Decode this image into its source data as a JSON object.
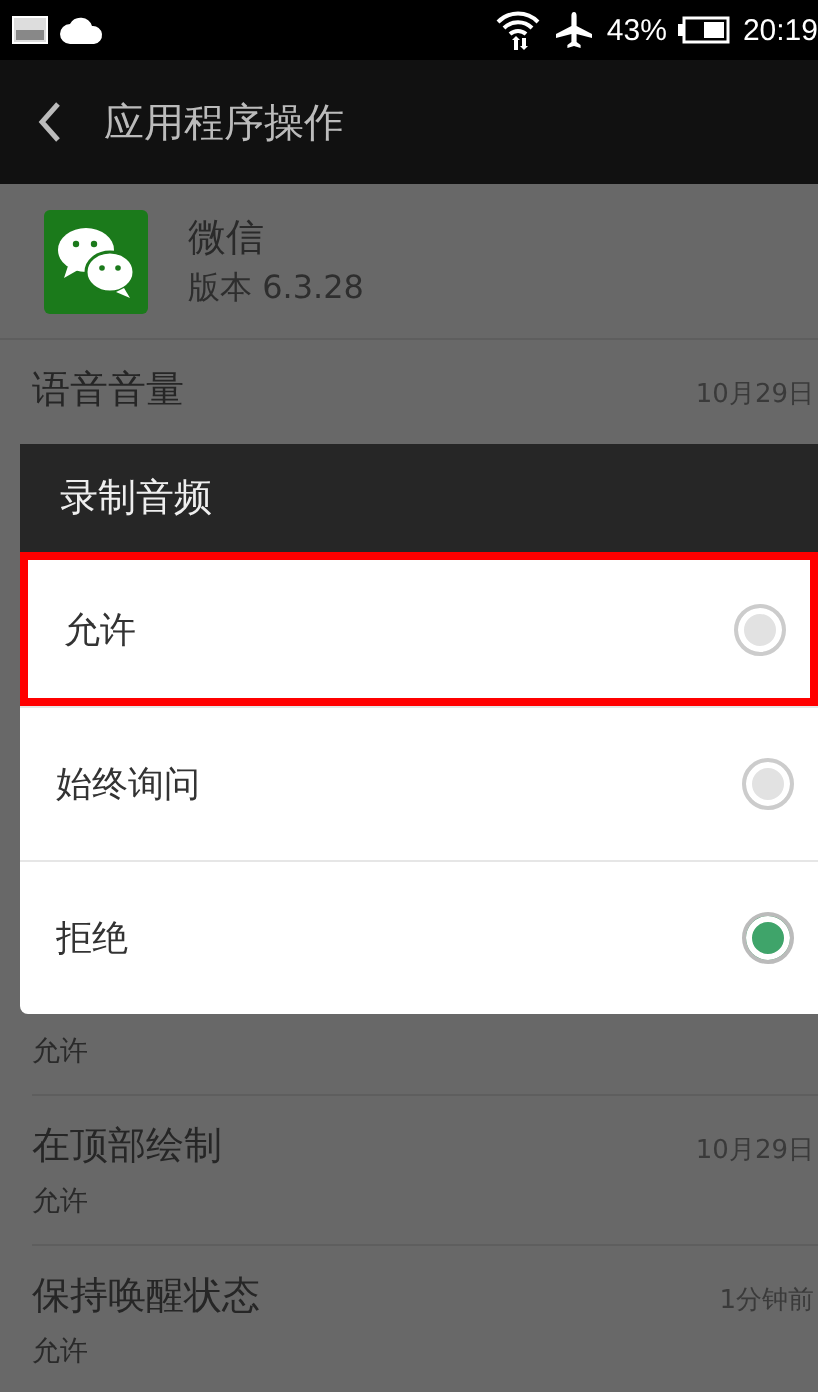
{
  "status_bar": {
    "battery_percent": "43%",
    "time": "20:19"
  },
  "app_bar": {
    "title": "应用程序操作"
  },
  "app": {
    "name": "微信",
    "version": "版本 6.3.28"
  },
  "permissions": [
    {
      "title": "语音音量",
      "time": "10月29日"
    },
    {
      "subtitle": "允许"
    },
    {
      "title": "在顶部绘制",
      "subtitle": "允许",
      "time": "10月29日"
    },
    {
      "title": "保持唤醒状态",
      "subtitle": "允许",
      "time": "1分钟前"
    }
  ],
  "dialog": {
    "title": "录制音频",
    "options": [
      {
        "label": "允许",
        "selected": false,
        "highlighted": true
      },
      {
        "label": "始终询问",
        "selected": false,
        "highlighted": false
      },
      {
        "label": "拒绝",
        "selected": true,
        "highlighted": false
      }
    ]
  }
}
